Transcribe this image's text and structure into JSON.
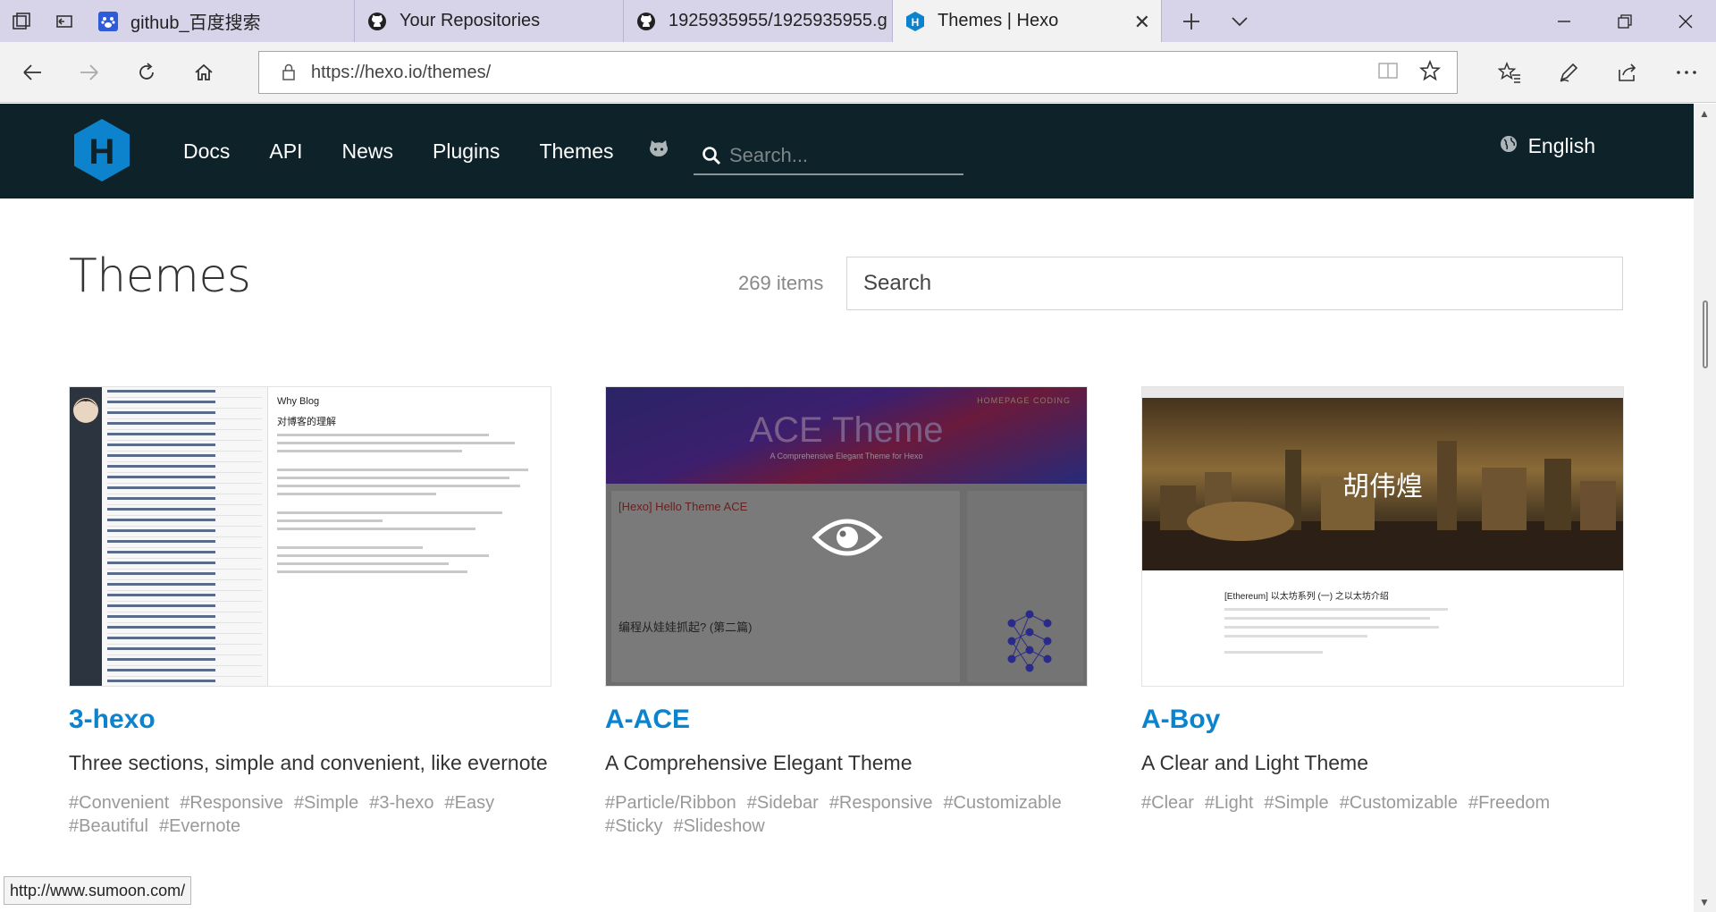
{
  "browser": {
    "tabs": [
      {
        "title": "github_百度搜索",
        "icon": "baidu-paw-icon",
        "active": false
      },
      {
        "title": "Your Repositories",
        "icon": "github-icon",
        "active": false
      },
      {
        "title": "1925935955/1925935955.g",
        "icon": "github-icon",
        "active": false
      },
      {
        "title": "Themes | Hexo",
        "icon": "hexo-icon",
        "active": true
      }
    ],
    "url": "https://hexo.io/themes/",
    "status_url": "http://www.sumoon.com/"
  },
  "site": {
    "logo_letter": "H",
    "nav": [
      "Docs",
      "API",
      "News",
      "Plugins",
      "Themes"
    ],
    "search_placeholder": "Search...",
    "language": "English"
  },
  "themes_page": {
    "title": "Themes",
    "count": "269 items",
    "search_placeholder": "Search"
  },
  "cards": [
    {
      "name": "3-hexo",
      "description": "Three sections, simple and convenient, like evernote",
      "tags": [
        "#Convenient",
        "#Responsive",
        "#Simple",
        "#3-hexo",
        "#Easy",
        "#Beautiful",
        "#Evernote"
      ],
      "preview": {
        "heading": "Why Blog",
        "sub": "对博客的理解"
      }
    },
    {
      "name": "A-ACE",
      "description": "A Comprehensive Elegant Theme",
      "tags": [
        "#Particle/Ribbon",
        "#Sidebar",
        "#Responsive",
        "#Customizable",
        "#Sticky",
        "#Slideshow"
      ],
      "preview": {
        "heading": "ACE Theme",
        "sub": "A Comprehensive Elegant Theme for Hexo",
        "nav": "HOMEPAGE   CODING",
        "post1": "[Hexo] Hello Theme ACE",
        "post2": "编程从娃娃抓起? (第二篇)"
      }
    },
    {
      "name": "A-Boy",
      "description": "A Clear and Light Theme",
      "tags": [
        "#Clear",
        "#Light",
        "#Simple",
        "#Customizable",
        "#Freedom"
      ],
      "preview": {
        "heading": "胡伟煌",
        "post": "[Ethereum] 以太坊系列 (一) 之以太坊介绍"
      }
    }
  ],
  "colors": {
    "header_bg": "#0e2229",
    "link_blue": "#0e83cd",
    "hexo_logo": "#0e83cd"
  }
}
